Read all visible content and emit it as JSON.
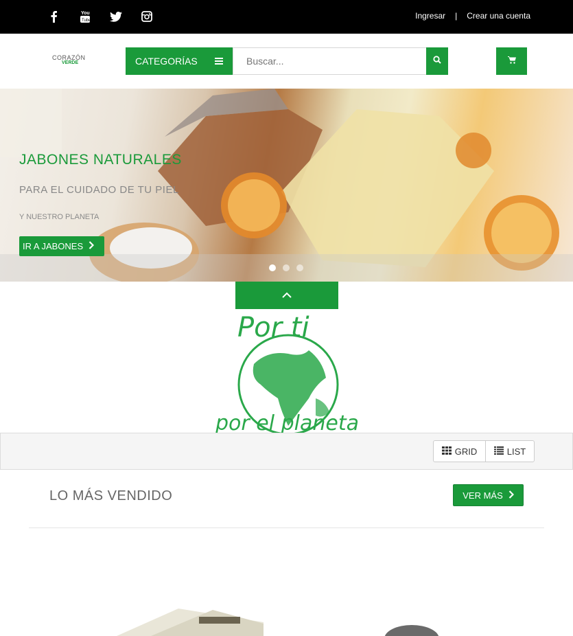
{
  "topbar": {
    "social": [
      {
        "name": "facebook-icon",
        "glyph": "f"
      },
      {
        "name": "youtube-icon",
        "glyph": "You Tube"
      },
      {
        "name": "twitter-icon",
        "glyph": "twitter"
      },
      {
        "name": "instagram-icon",
        "glyph": "instagram"
      }
    ],
    "login_label": "Ingresar",
    "separator": "|",
    "register_label": "Crear una cuenta"
  },
  "header": {
    "logo_top": "CORAZÓN",
    "logo_bottom": "VERDE",
    "categories_label": "CATEGORÍAS",
    "search_placeholder": "Buscar...",
    "search_icon": "search-icon",
    "cart_icon": "cart-icon"
  },
  "hero": {
    "title": "JABONES NATURALES",
    "subtitle": "PARA EL CUIDADO DE TU PIEL",
    "subtitle2": "Y NUESTRO PLANETA",
    "button_label": "IR A JABONES",
    "slides": 3,
    "active_slide": 1
  },
  "globe": {
    "line1": "Por ti",
    "line2": "por el planeta"
  },
  "view_toggle": {
    "grid_label": "GRID",
    "list_label": "LIST"
  },
  "section": {
    "title": "LO MÁS VENDIDO",
    "more_label": "VER MÁS"
  },
  "colors": {
    "brand_green": "#1a9a3a",
    "topbar_bg": "#000000"
  }
}
